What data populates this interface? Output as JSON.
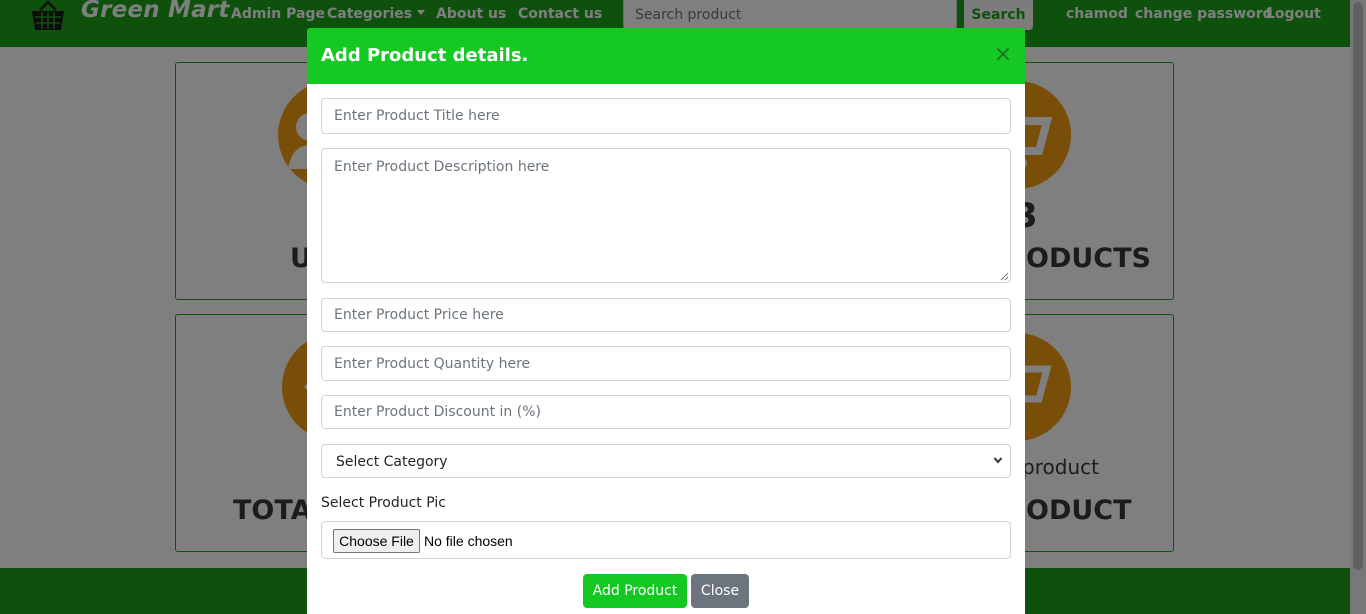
{
  "brand": {
    "name": "Green Mart"
  },
  "nav": {
    "admin": "Admin Page",
    "categories": "Categories",
    "about": "About us",
    "contact": "Contact us",
    "user": "chamod",
    "change_password": "change password",
    "logout": "Logout"
  },
  "search": {
    "placeholder": "Search product",
    "button": "Search"
  },
  "background": {
    "card_users_title": "U",
    "card_products_count": "3",
    "card_products_title": "ODUCTS",
    "card_categories_title": "TOTAL",
    "card_add_sub": "d product",
    "card_add_title": "ODUCT"
  },
  "modal": {
    "title": "Add Product details.",
    "close_icon": "×",
    "title_placeholder": "Enter Product Title here",
    "description_placeholder": "Enter Product Description here",
    "price_placeholder": "Enter Product Price here",
    "quantity_placeholder": "Enter Product Quantity here",
    "discount_placeholder": "Enter Product Discount in (%)",
    "category_select": "Select Category",
    "pic_label": "Select Product Pic",
    "choose_file": "Choose File",
    "file_status": "No file chosen",
    "add_button": "Add Product",
    "close_button": "Close"
  },
  "colors": {
    "nav_green": "#1aa31a",
    "header_green": "#14c921",
    "button_green": "#13c921",
    "secondary_gray": "#6c757d",
    "icon_orange": "#f39c12"
  }
}
